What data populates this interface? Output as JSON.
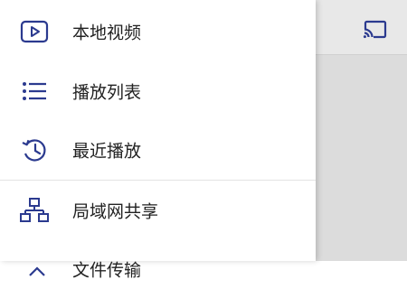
{
  "theme": {
    "accent": "#2b3a8f",
    "text": "#222222"
  },
  "background": {
    "cast_icon": "cast-icon"
  },
  "drawer": {
    "items": [
      {
        "label": "本地视频",
        "icon": "video-icon"
      },
      {
        "label": "播放列表",
        "icon": "playlist-icon"
      },
      {
        "label": "最近播放",
        "icon": "history-icon"
      },
      {
        "label": "局域网共享",
        "icon": "network-share-icon"
      },
      {
        "label": "文件传输",
        "icon": "transfer-icon"
      }
    ]
  }
}
